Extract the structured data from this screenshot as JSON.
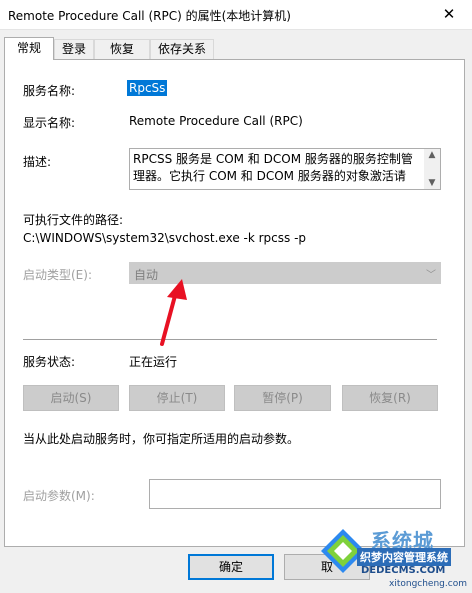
{
  "window": {
    "title": "Remote Procedure Call (RPC) 的属性(本地计算机)",
    "close_glyph": "✕"
  },
  "tabs": [
    {
      "label": "常规",
      "active": true
    },
    {
      "label": "登录",
      "active": false
    },
    {
      "label": "恢复",
      "active": false
    },
    {
      "label": "依存关系",
      "active": false
    }
  ],
  "general": {
    "service_name_label": "服务名称:",
    "service_name_value": "RpcSs",
    "display_name_label": "显示名称:",
    "display_name_value": "Remote Procedure Call (RPC)",
    "description_label": "描述:",
    "description_value": "RPCSS 服务是 COM 和 DCOM 服务器的服务控制管理器。它执行 COM 和 DCOM 服务器的对象激活请",
    "exe_path_label": "可执行文件的路径:",
    "exe_path_value": "C:\\WINDOWS\\system32\\svchost.exe -k rpcss -p",
    "startup_type_label": "启动类型(E):",
    "startup_type_value": "自动",
    "service_status_label": "服务状态:",
    "service_status_value": "正在运行",
    "buttons": {
      "start": "启动(S)",
      "stop": "停止(T)",
      "pause": "暂停(P)",
      "resume": "恢复(R)"
    },
    "hint_text": "当从此处启动服务时，你可指定所适用的启动参数。",
    "start_params_label": "启动参数(M):",
    "start_params_value": ""
  },
  "footer": {
    "ok": "确定",
    "cancel": "取"
  },
  "annotation": {
    "color": "#e81123"
  },
  "watermark": {
    "brand": "系统城",
    "subtitle": "织梦内容管理系统",
    "domain": "DEDECMS.COM",
    "site": "xitongcheng.com"
  },
  "colors": {
    "accent": "#0078d7",
    "window_bg": "#f0f0f0",
    "panel_bg": "#ffffff",
    "disabled_text": "#a0a0a0"
  }
}
